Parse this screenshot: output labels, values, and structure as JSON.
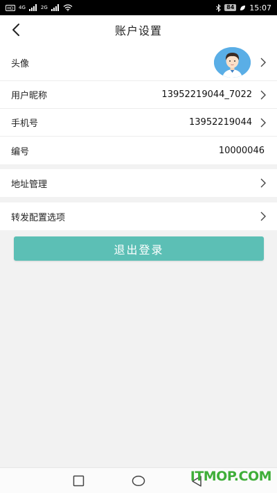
{
  "status_bar": {
    "signal_1": "4G",
    "signal_2": "2G",
    "battery": "84",
    "time": "15:07"
  },
  "header": {
    "title": "账户设置"
  },
  "profile_group": {
    "avatar_label": "头像",
    "nickname_label": "用户昵称",
    "nickname_value": "13952219044_7022",
    "phone_label": "手机号",
    "phone_value": "13952219044",
    "id_label": "编号",
    "id_value": "10000046"
  },
  "address_group": {
    "label": "地址管理"
  },
  "forward_group": {
    "label": "转发配置选项"
  },
  "logout": {
    "label": "退出登录"
  },
  "watermark": "ITMOP.COM",
  "colors": {
    "accent": "#5cbfb5",
    "watermark": "#3fae39"
  }
}
